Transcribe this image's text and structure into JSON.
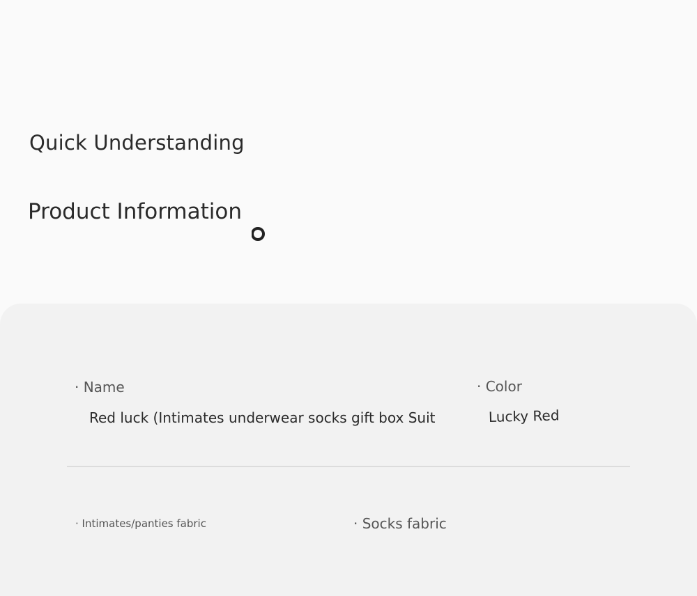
{
  "sections": {
    "quick_heading": "Quick Understanding",
    "info_heading": "Product Information"
  },
  "product": {
    "name_label": "· Name",
    "name_value": "Red luck (Intimates underwear socks gift box Suit",
    "color_label": "· Color",
    "color_value": "Lucky Red",
    "fabric_label": "· Intimates/panties fabric",
    "socks_label": "· Socks fabric"
  },
  "icons": {
    "ring": "ring-icon"
  },
  "colors": {
    "page_background": "#fafafa",
    "card_background": "#f2f2f2",
    "divider": "#dcdcdc",
    "text_primary": "#2a2a2a",
    "text_label": "#555555"
  }
}
